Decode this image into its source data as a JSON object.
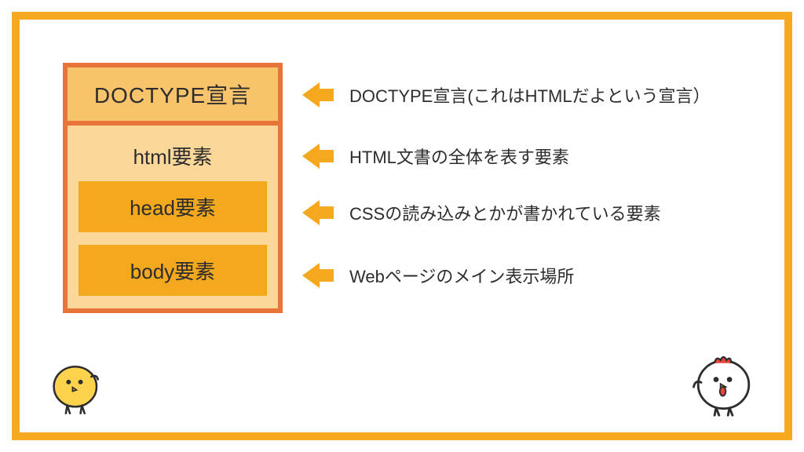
{
  "colors": {
    "border_orange": "#f4a81d",
    "box_border_red": "#e8743a",
    "box_bg_light": "#fbd89a",
    "doctype_bg": "#f7c36b",
    "inner_box_bg": "#f4a81d",
    "text": "#2d2d2d"
  },
  "diagram": {
    "doctype": "DOCTYPE宣言",
    "html_label": "html要素",
    "head_label": "head要素",
    "body_label": "body要素"
  },
  "annotations": [
    {
      "text": "DOCTYPE宣言(これはHTMLだよという宣言）"
    },
    {
      "text": "HTML文書の全体を表す要素"
    },
    {
      "text": "CSSの読み込みとかが書かれている要素"
    },
    {
      "text": "Webページのメイン表示場所"
    }
  ],
  "decor": {
    "chick": "chick-character-icon",
    "chicken": "chicken-character-icon"
  }
}
